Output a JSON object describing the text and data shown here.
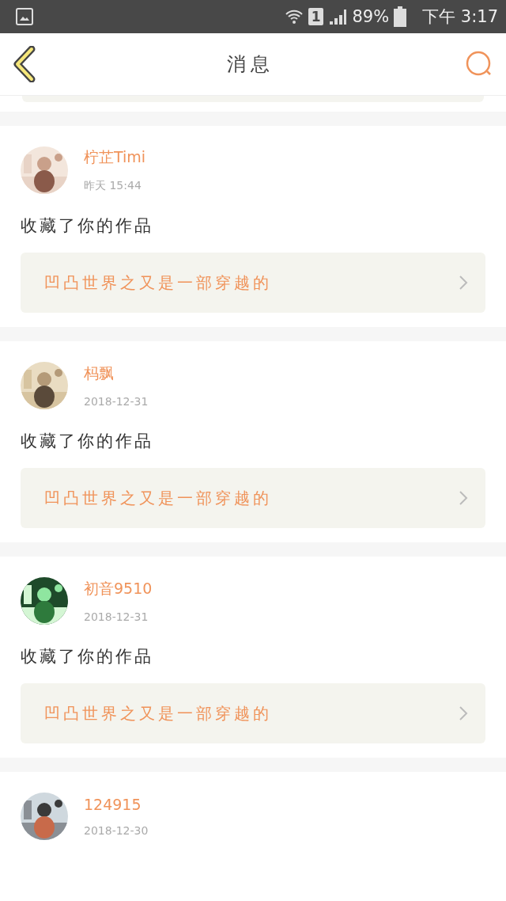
{
  "status_bar": {
    "sim": "1",
    "battery": "89%",
    "time": "下午 3:17"
  },
  "header": {
    "title": "消息"
  },
  "messages": [
    {
      "user": "柠芷Timi",
      "date": "昨天  15:44",
      "action": "收藏了你的作品",
      "work": "凹凸世界之又是一部穿越的"
    },
    {
      "user": "杩飘",
      "date": "2018-12-31",
      "action": "收藏了你的作品",
      "work": "凹凸世界之又是一部穿越的"
    },
    {
      "user": "初音9510",
      "date": "2018-12-31",
      "action": "收藏了你的作品",
      "work": "凹凸世界之又是一部穿越的"
    },
    {
      "user": "124915",
      "date": "2018-12-30"
    }
  ]
}
